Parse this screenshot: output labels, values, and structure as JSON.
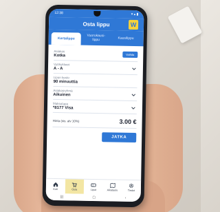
{
  "status": {
    "time": "12:38",
    "right": "▾ ▴ ▮"
  },
  "header": {
    "title": "Osta lippu",
    "logo_letter": "W"
  },
  "tabs": [
    {
      "label": "Kertalippu"
    },
    {
      "label": "Vuorokausi-\nlippu"
    },
    {
      "label": "Kausilippu"
    }
  ],
  "form": {
    "customer": {
      "label": "Asiakas",
      "value": "Kotka",
      "action": "Vaihda"
    },
    "zones": {
      "label": "Vyöhykkeet",
      "value": "A - A"
    },
    "validity": {
      "label": "Lipun kesto",
      "value": "90 minuuttia"
    },
    "customer_group": {
      "label": "Asiakasryhmä",
      "value": "Aikuinen"
    },
    "payment": {
      "label": "Maksutapa",
      "value": "*8177 Visa"
    }
  },
  "price": {
    "label": "Hinta (sis. alv 10%)",
    "value": "3.00 €"
  },
  "continue_label": "JATKA",
  "bottom_nav": [
    {
      "label": "Koti",
      "icon": "home-icon"
    },
    {
      "label": "Osta",
      "icon": "cart-icon"
    },
    {
      "label": "Liput",
      "icon": "ticket-icon"
    },
    {
      "label": "Aikataulu",
      "icon": "map-icon"
    },
    {
      "label": "Tiedot",
      "icon": "gear-icon"
    }
  ],
  "colors": {
    "primary": "#2f78d6",
    "accent": "#f6d23a",
    "active_nav": "#f3e6a3"
  }
}
